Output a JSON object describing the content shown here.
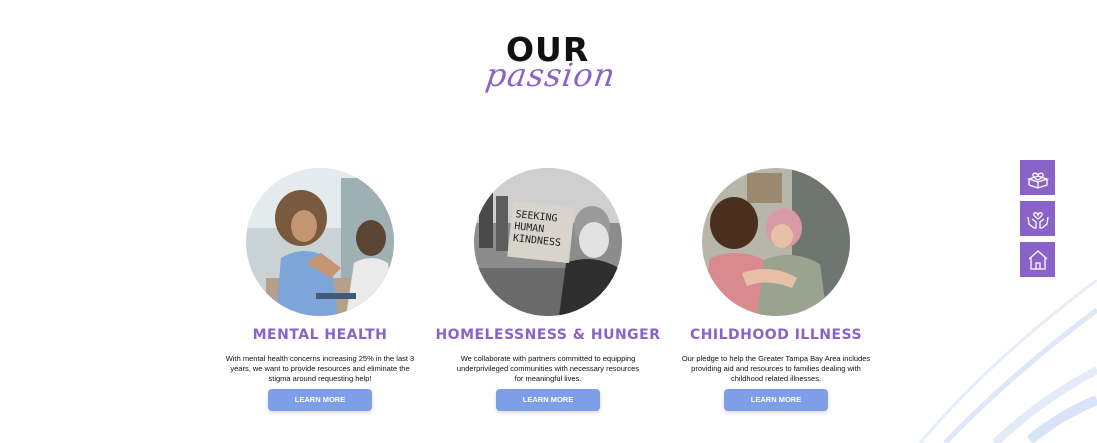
{
  "heading": {
    "line1": "OUR",
    "line2": "passion"
  },
  "cards": [
    {
      "title": "MENTAL HEALTH",
      "description": "With mental health concerns increasing 25% in the last 3 years, we want to provide resources and eliminate the stigma around requesting help!",
      "button": "LEARN MORE"
    },
    {
      "title": "HOMELESSNESS & HUNGER",
      "description": "We collaborate with partners committed to equipping underprivileged communities with necessary resources for meaningful lives.",
      "button": "LEARN MORE",
      "sign_text": "SEEKING HUMAN KINDNESS"
    },
    {
      "title": "CHILDHOOD ILLNESS",
      "description": "Our pledge to help the Greater Tampa Bay Area includes providing aid and resources to families dealing with childhood related illnesses.",
      "button": "LEARN MORE"
    }
  ],
  "side_icons": [
    "heart-box-icon",
    "hands-heart-icon",
    "home-icon"
  ],
  "colors": {
    "accent": "#8a63c9",
    "button": "#7f9ee8"
  }
}
